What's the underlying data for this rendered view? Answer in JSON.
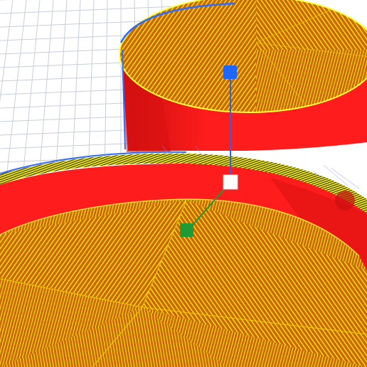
{
  "viewport": {
    "background": "#ffffff",
    "grid_color": "#c7ced9",
    "shell_color": "#ff1c1c",
    "shell_shade_color": "#d81010",
    "infill_color": "#c86a00",
    "infill_line_color": "#ffdf1a",
    "skirt_color": "#ffff3a",
    "travel_color": "#7f8cff",
    "selection_outline_color": "#2f6bff",
    "objects": [
      {
        "name": "top-right-cylinder"
      },
      {
        "name": "front-cylinder"
      }
    ],
    "gizmo": {
      "axes": [
        {
          "axis": "z",
          "color": "#1e66ff",
          "handle": "move-z-handle"
        },
        {
          "axis": "y",
          "color": "#1f9a35",
          "handle": "move-y-handle"
        },
        {
          "axis": "origin",
          "color": "#ffffff",
          "handle": "move-origin-handle"
        }
      ]
    }
  }
}
